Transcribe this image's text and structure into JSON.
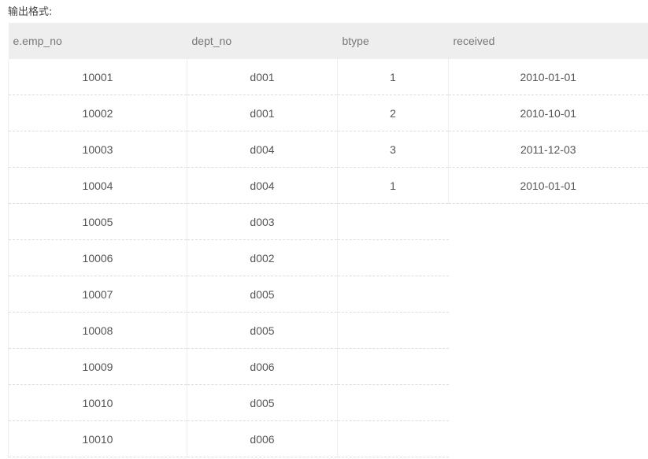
{
  "caption": "输出格式:",
  "table": {
    "headers": [
      "e.emp_no",
      "dept_no",
      "btype",
      "received"
    ],
    "rows": [
      [
        "10001",
        "d001",
        "1",
        "2010-01-01"
      ],
      [
        "10002",
        "d001",
        "2",
        "2010-10-01"
      ],
      [
        "10003",
        "d004",
        "3",
        "2011-12-03"
      ],
      [
        "10004",
        "d004",
        "1",
        "2010-01-01"
      ],
      [
        "10005",
        "d003",
        "",
        ""
      ],
      [
        "10006",
        "d002",
        "",
        ""
      ],
      [
        "10007",
        "d005",
        "",
        ""
      ],
      [
        "10008",
        "d005",
        "",
        ""
      ],
      [
        "10009",
        "d006",
        "",
        ""
      ],
      [
        "10010",
        "d005",
        "",
        ""
      ],
      [
        "10010",
        "d006",
        "",
        ""
      ]
    ]
  }
}
